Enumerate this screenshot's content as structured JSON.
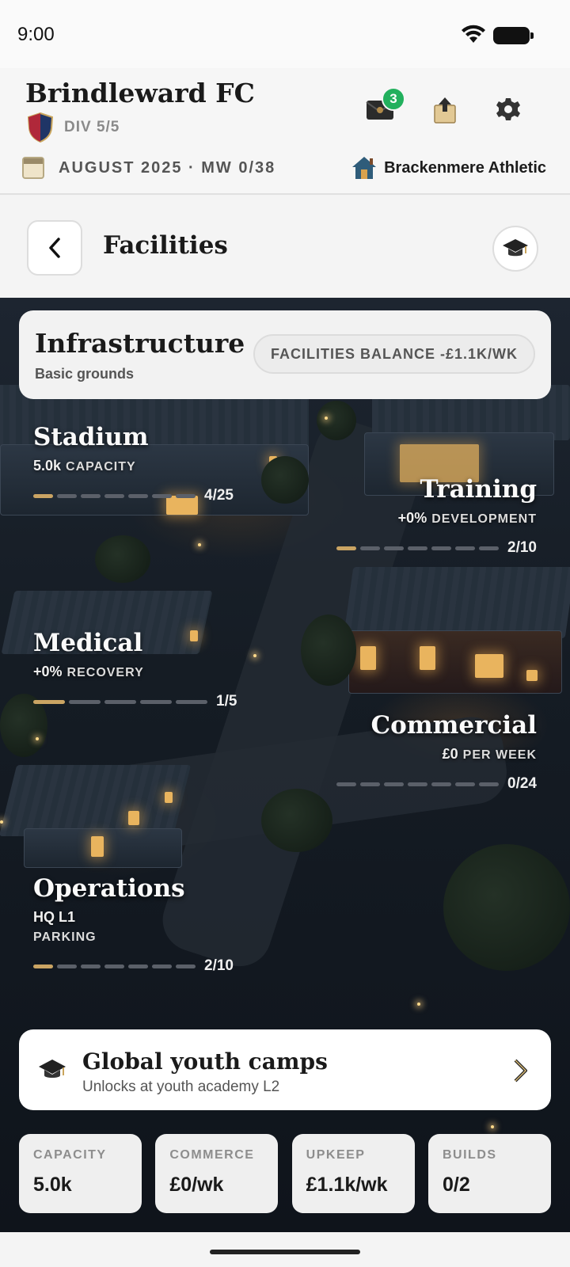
{
  "status_bar": {
    "time": "9:00"
  },
  "club": {
    "name": "Brindleward FC",
    "division": "DIV 5/5",
    "inbox_badge": "3",
    "date_line": "AUGUST 2025 · MW 0/38",
    "next_opponent": "Brackenmere Athletic",
    "icons": [
      "mail-icon",
      "upload-box-icon",
      "gear-icon",
      "calendar-icon",
      "home-icon",
      "crest-icon"
    ]
  },
  "page": {
    "title": "Facilities"
  },
  "infrastructure": {
    "title": "Infrastructure",
    "subtitle": "Basic grounds",
    "balance": "FACILITIES BALANCE -£1.1K/WK"
  },
  "facilities": {
    "stadium": {
      "name": "Stadium",
      "value": "5.0k",
      "unit": "CAPACITY",
      "level": "4/25",
      "level_current": 4,
      "level_max": 25
    },
    "training": {
      "name": "Training",
      "value": "+0%",
      "unit": "DEVELOPMENT",
      "level": "2/10",
      "level_current": 2,
      "level_max": 10
    },
    "medical": {
      "name": "Medical",
      "value": "+0%",
      "unit": "RECOVERY",
      "level": "1/5",
      "level_current": 1,
      "level_max": 5
    },
    "commercial": {
      "name": "Commercial",
      "value": "£0",
      "unit": "PER WEEK",
      "level": "0/24",
      "level_current": 0,
      "level_max": 24
    },
    "operations": {
      "name": "Operations",
      "value": "HQ L1",
      "unit": "PARKING",
      "level": "2/10",
      "level_current": 2,
      "level_max": 10
    }
  },
  "youth_camps": {
    "title": "Global youth camps",
    "subtitle": "Unlocks at youth academy L2"
  },
  "summary": [
    {
      "label": "CAPACITY",
      "value": "5.0k"
    },
    {
      "label": "COMMERCE",
      "value": "£0/wk"
    },
    {
      "label": "UPKEEP",
      "value": "£1.1k/wk"
    },
    {
      "label": "BUILDS",
      "value": "0/2"
    }
  ],
  "colors": {
    "accent_gold": "#caa463",
    "badge_green": "#22b05d"
  }
}
